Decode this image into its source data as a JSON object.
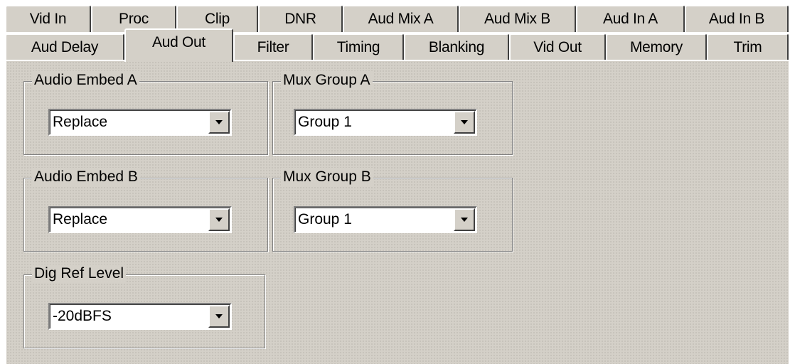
{
  "tabs": {
    "row_back": [
      "Vid In",
      "Proc",
      "Clip",
      "DNR",
      "Aud Mix A",
      "Aud Mix B",
      "Aud In A",
      "Aud In B"
    ],
    "row_front": [
      "Aud Delay",
      "Aud Out",
      "Filter",
      "Timing",
      "Blanking",
      "Vid Out",
      "Memory",
      "Trim"
    ],
    "active": "Aud Out"
  },
  "groups": {
    "audio_embed_a": {
      "label": "Audio Embed A",
      "value": "Replace"
    },
    "mux_group_a": {
      "label": "Mux Group A",
      "value": "Group 1"
    },
    "audio_embed_b": {
      "label": "Audio Embed B",
      "value": "Replace"
    },
    "mux_group_b": {
      "label": "Mux Group B",
      "value": "Group 1"
    },
    "dig_ref_level": {
      "label": "Dig Ref Level",
      "value": "-20dBFS"
    }
  },
  "icons": {
    "dropdown": "down-arrow-icon"
  },
  "colors": {
    "face": "#d4d0c8",
    "highlight": "#ffffff",
    "shadow": "#808080",
    "dark_shadow": "#404040"
  }
}
